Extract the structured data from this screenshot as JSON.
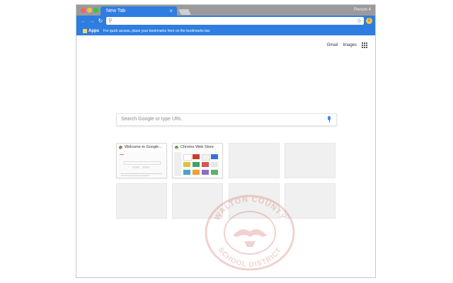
{
  "browser": {
    "tab": {
      "title": "New Tab",
      "close_glyph": "×"
    },
    "profile_name": "Person 4",
    "nav": {
      "back_glyph": "←",
      "forward_glyph": "→",
      "reload_glyph": "↻"
    },
    "omnibox": {
      "value": "",
      "search_glyph": "⚲",
      "star_glyph": "☆"
    },
    "extension_badge": "1"
  },
  "bookmarks_bar": {
    "apps_label": "Apps",
    "hint": "For quick access, place your bookmarks here on the bookmarks bar."
  },
  "new_tab_page": {
    "top_links": [
      "Gmail",
      "Images"
    ],
    "search_placeholder": "Search Google or type URL",
    "tiles": [
      {
        "title": "Welcome to Google..."
      },
      {
        "title": "Chrome Web Store"
      }
    ]
  },
  "watermark": {
    "text_top": "WALTON COUNTY",
    "text_bottom": "SCHOOL DISTRICT"
  },
  "colors": {
    "accent": "#2f7de1",
    "tab_strip": "#9b9b9b",
    "tile_placeholder": "#f0f0f0",
    "crest": "#c0392b"
  }
}
